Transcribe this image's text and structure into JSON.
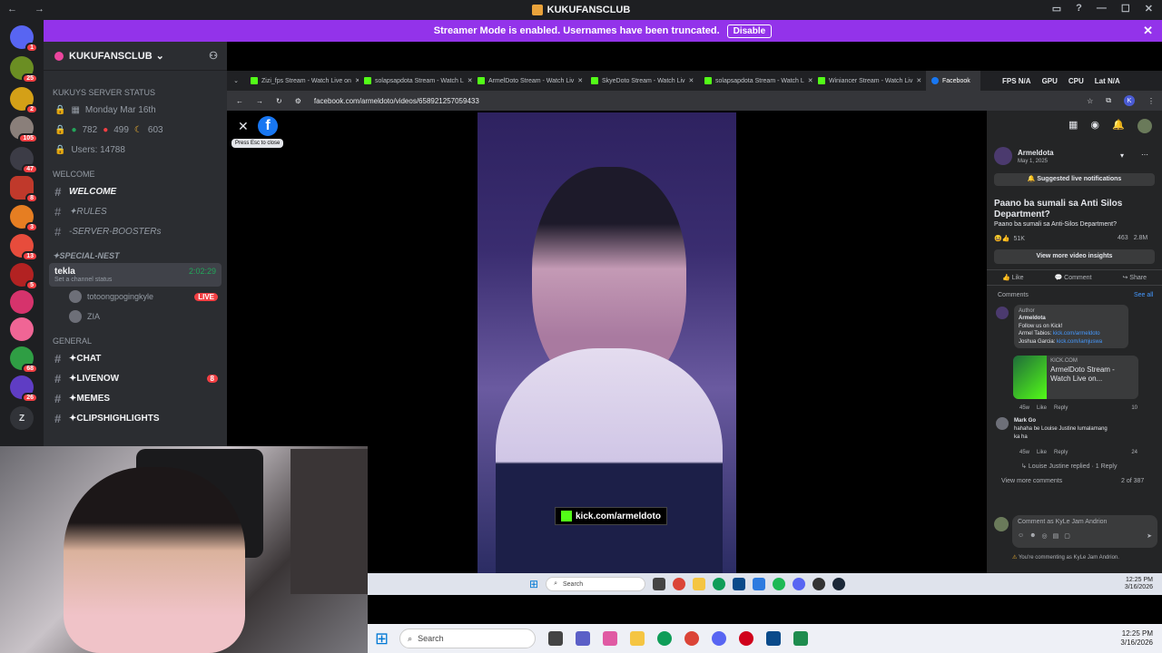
{
  "titlebar": {
    "title": "KUKUFANSCLUB"
  },
  "banner": {
    "message": "Streamer Mode is enabled. Usernames have been truncated.",
    "button": "Disable"
  },
  "rail": {
    "badges": [
      "1",
      "25",
      "2",
      "105",
      "47",
      "8",
      "3",
      "13",
      "5",
      "68",
      "26",
      "Z"
    ]
  },
  "sidebar": {
    "server_name": "KUKUFANSCLUB",
    "status_category": "KUKUYS SERVER STATUS",
    "status": [
      "Monday Mar 16th",
      "782",
      "499",
      "603",
      "Users: 14788"
    ],
    "welcome_category": "WELCOME",
    "welcome_channels": [
      "WELCOME",
      "✦RULES",
      "-SERVER-BOOSTERs"
    ],
    "nest_category": "✦Special-Nest",
    "voice": {
      "name": "tekla",
      "time": "2:02:29",
      "status": "Set a channel status"
    },
    "voice_users": [
      "totoongpogingkyle",
      "ZIA"
    ],
    "live_label": "LIVE",
    "general_category": "GENERAL",
    "general_channels": [
      "✦CHAT",
      "✦LIVENOW",
      "✦MEMES",
      "✦CLIPSHIGHLIGHTS"
    ],
    "livenow_count": "8"
  },
  "browser": {
    "tabs": [
      "Zizi_fps Stream - Watch Live on",
      "solapsapdota Stream - Watch L",
      "ArmelDoto Stream - Watch Liv",
      "SkyeDoto Stream - Watch Liv",
      "solapsapdota Stream - Watch L",
      "Winiancer Stream - Watch Liv",
      "Facebook"
    ],
    "stats": [
      "FPS N/A",
      "GPU",
      "CPU",
      "Lat N/A"
    ],
    "url": "facebook.com/armeldoto/videos/658921257059433"
  },
  "viewer": {
    "esc_hint": "Press Esc to close",
    "kick_overlay": "kick.com/armeldoto"
  },
  "panel": {
    "author": "Armeldota",
    "date": "May 1, 2025",
    "notify": "Suggested live notifications",
    "title": "Paano ba sumali sa Anti Silos Department?",
    "subtitle": "Paano ba sumali sa Anti-Silos Department?",
    "reactions": "51K",
    "comments_count": "463",
    "views": "2.8M",
    "insights": "View more video insights",
    "actions": [
      "Like",
      "Comment",
      "Share"
    ],
    "comments_label": "Comments",
    "see_all": "See all",
    "c1_tag": "Author",
    "c1_name": "Armeldota",
    "c1_lines": [
      "Follow us on Kick!",
      "Armel Tabios:",
      "kick.com/armeldoto",
      "Joshua Garcia:",
      "kick.com/iamjuswa"
    ],
    "c1_card_site": "KICK.COM",
    "c1_card_title": "ArmelDoto Stream - Watch Live on...",
    "c1_meta": [
      "45w",
      "Like",
      "Reply",
      "10"
    ],
    "c2_name": "Mark Go",
    "c2_text": "hahaha be Louise Justine lumalamang ka ha",
    "c2_meta": [
      "45w",
      "Like",
      "Reply",
      "24"
    ],
    "c2_reply": "Louise Justine replied · 1 Reply",
    "more": "View more comments",
    "paging": "2 of 387",
    "input_placeholder": "Comment as KyLe Jam Andrion",
    "commenting_as": "You're commenting as KyLe Jam Andrion."
  },
  "taskbar_inner": {
    "search": "Search",
    "time": "12:25 PM",
    "date": "3/16/2026"
  },
  "taskbar": {
    "search": "Search",
    "time": "12:25 PM",
    "date": "3/16/2026"
  }
}
